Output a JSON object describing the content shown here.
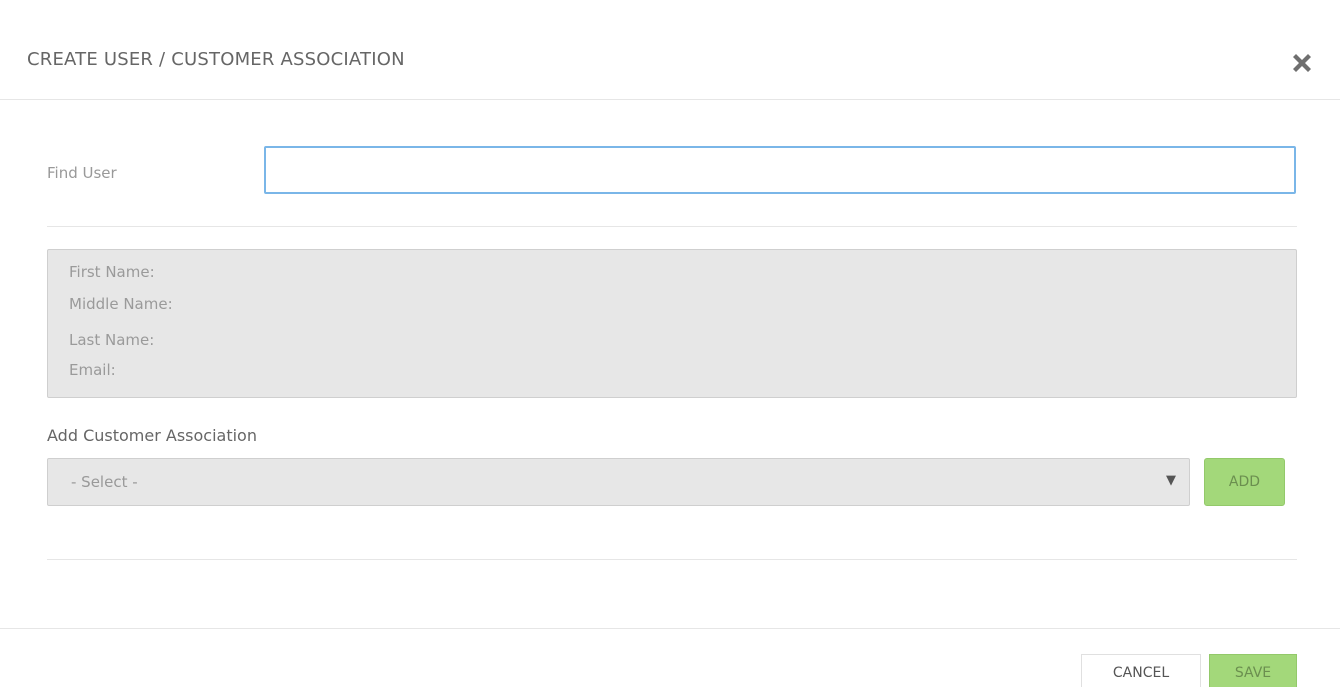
{
  "header": {
    "title": "CREATE USER / CUSTOMER ASSOCIATION",
    "close_icon": "close-icon"
  },
  "find_user": {
    "label": "Find User",
    "value": "",
    "placeholder": ""
  },
  "user_info": {
    "first_name_label": "First Name:",
    "middle_name_label": "Middle Name:",
    "last_name_label": "Last Name:",
    "email_label": "Email:"
  },
  "customer_association": {
    "label": "Add Customer Association",
    "select_value": "- Select -",
    "caret_icon": "caret-down-icon",
    "add_label": "ADD"
  },
  "footer": {
    "cancel_label": "CANCEL",
    "save_label": "SAVE"
  },
  "colors": {
    "primary_green": "#a3d87a",
    "input_focus_border": "#7ab6e8",
    "panel_gray": "#e7e7e7"
  }
}
